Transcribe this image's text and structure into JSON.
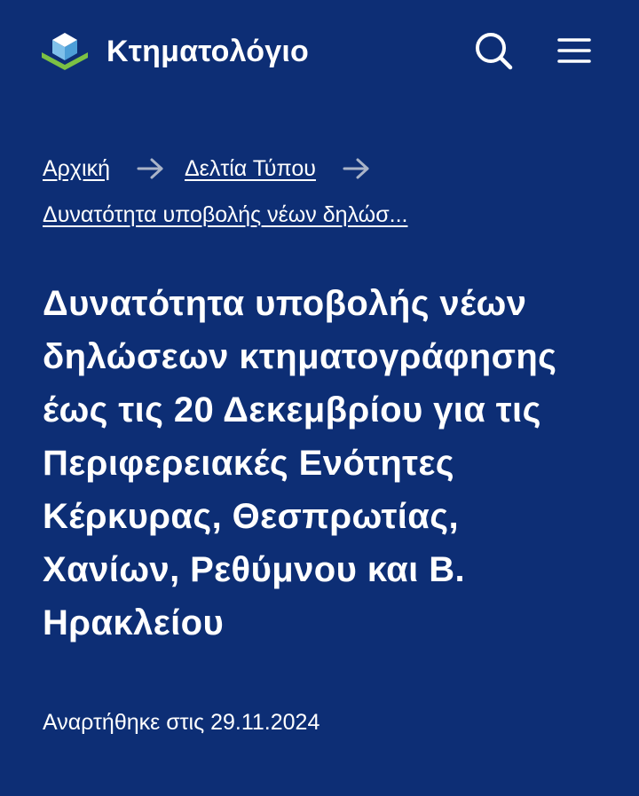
{
  "header": {
    "brand": "Κτηματολόγιο",
    "search_icon": "search-icon",
    "menu_icon": "hamburger-menu-icon",
    "logo_icon": "cadastre-logo-icon"
  },
  "breadcrumb": {
    "items": [
      {
        "label": "Αρχική"
      },
      {
        "label": "Δελτία Τύπου"
      },
      {
        "label": "Δυνατότητα υποβολής νέων δηλώσ..."
      }
    ],
    "separator_icon": "arrow-right-icon"
  },
  "article": {
    "title": "Δυνατότητα υποβολής νέων δηλώσεων κτηματογράφησης έως τις 20 Δεκεμβρίου για τις Περιφερειακές Ενότητες Κέρκυρας, Θεσπρωτίας, Χανίων, Ρεθύμνου και Β. Ηρακλείου",
    "posted": "Αναρτήθηκε στις 29.11.2024"
  },
  "colors": {
    "background": "#0d2e75",
    "text": "#ffffff",
    "logo_light_blue": "#7fc0ea",
    "logo_white": "#ffffff",
    "logo_green": "#7cc144",
    "separator": "#aab4c8"
  }
}
